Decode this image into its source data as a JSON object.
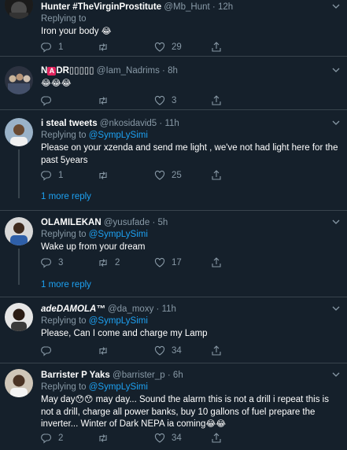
{
  "tweets": [
    {
      "name": "Hunter #TheVirginProstitute",
      "handle": "@Mb_Hunt",
      "time": "12h",
      "reply_prefix": "Replying to ",
      "reply_mention": "",
      "text": "Iron your body",
      "emoji": "😂",
      "replies": "1",
      "retweets": "",
      "likes": "29"
    },
    {
      "name_letter": "N",
      "name_badge": "A",
      "name_rest": "DR▯▯▯▯▯",
      "handle": "@Iam_Nadrims",
      "time": "8h",
      "emoji": "😂😂😂",
      "replies": "",
      "retweets": "",
      "likes": "3"
    },
    {
      "name": "i steal tweets",
      "handle": "@nkosidavid5",
      "time": "11h",
      "reply_prefix": "Replying to ",
      "reply_mention": "@SympLySimi",
      "text": "Please on your xzenda and send me light , we've not had light here for the past 5years",
      "replies": "1",
      "retweets": "",
      "likes": "25",
      "more": "1 more reply"
    },
    {
      "name": "OLAMILEKAN",
      "handle": "@yusufade",
      "time": "5h",
      "reply_prefix": "Replying to ",
      "reply_mention": "@SympLySimi",
      "text": "Wake up from your dream",
      "replies": "3",
      "retweets": "2",
      "likes": "17",
      "more": "1 more reply"
    },
    {
      "name": "adeDAMOLA™",
      "handle": "@da_moxy",
      "time": "11h",
      "reply_prefix": "Replying to ",
      "reply_mention": "@SympLySimi",
      "text": "Please, Can I come and charge my Lamp",
      "replies": "",
      "retweets": "",
      "likes": "34"
    },
    {
      "name": "Barrister P Yaks",
      "handle": "@barrister_p",
      "time": "6h",
      "reply_prefix": "Replying to ",
      "reply_mention": "@SympLySimi",
      "text_a": "May day",
      "emoji_a": "😯😯",
      "text_b": " may day...  Sound the alarm this is not a drill i repeat this is not a drill, charge all power banks, buy 10 gallons of fuel prepare the inverter...  Winter of Dark NEPA ia coming",
      "emoji_b": "😂😂",
      "replies": "2",
      "retweets": "",
      "likes": "34"
    }
  ],
  "separator": "·",
  "icons": [
    "reply-icon",
    "retweet-icon",
    "like-icon",
    "chevron-down-icon"
  ],
  "colors": {
    "background": "#15202b",
    "muted": "#8899a6",
    "accent": "#1da1f2",
    "border": "#38444d"
  }
}
